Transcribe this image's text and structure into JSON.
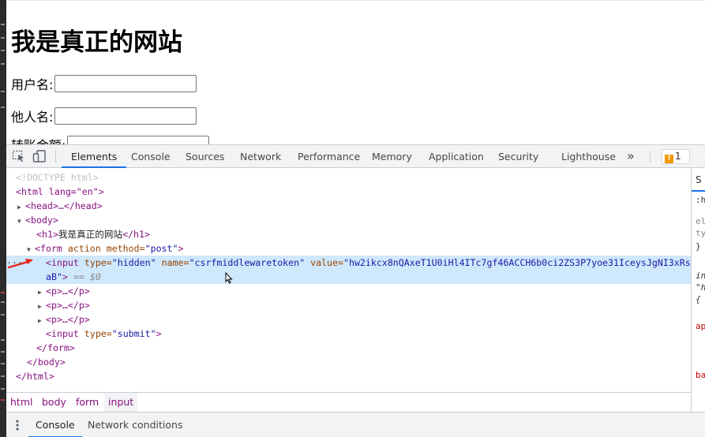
{
  "page": {
    "heading": "我是真正的网站",
    "fields": [
      {
        "label": "用户名:",
        "value": ""
      },
      {
        "label": "他人名:",
        "value": ""
      },
      {
        "label": "转账金额:",
        "value": ""
      }
    ]
  },
  "devtools": {
    "tabs": [
      "Elements",
      "Console",
      "Sources",
      "Network",
      "Performance",
      "Memory",
      "Application",
      "Security",
      "Lighthouse"
    ],
    "active_tab": "Elements",
    "more_tabs": "»",
    "issues_count": "1",
    "dom": {
      "doctype": "<!DOCTYPE html>",
      "html_open": "<html lang=\"en\">",
      "head": "<head>…</head>",
      "body_open": "<body>",
      "h1_open": "<h1>",
      "h1_text": "我是真正的网站",
      "h1_close": "</h1>",
      "form_open_tag": "<form",
      "form_attrs": " action method=",
      "form_method": "\"post\"",
      "form_open_end": ">",
      "input_tag": "<input",
      "input_type_attr": " type=",
      "input_type_val": "\"hidden\"",
      "input_name_attr": " name=",
      "input_name_val": "\"csrfmiddlewaretoken\"",
      "input_value_attr": " value=",
      "input_value_val": "\"hw2ikcx8nQAxeT1U0iHl4ITc7gf46ACCH6b0ci2ZS3P7yoe31IceysJgNI3xRs",
      "input_value_val2": "aB\"",
      "input_end": ">",
      "selected_marker": " == $0",
      "p_collapsed": "<p>…</p>",
      "submit_tag": "<input",
      "submit_type_attr": " type=",
      "submit_type_val": "\"submit\"",
      "submit_end": ">",
      "form_close": "</form>",
      "body_close": "</body>",
      "html_close": "</html>",
      "dots": "···"
    },
    "side_pane": {
      "tab": "S",
      "lines": [
        ":h",
        "el",
        "ty",
        "}",
        "in",
        "\"h",
        "{",
        "ap",
        "ba"
      ]
    },
    "breadcrumbs": [
      "html",
      "body",
      "form",
      "input"
    ],
    "active_breadcrumb": "input",
    "drawer_tabs": [
      "Console",
      "Network conditions"
    ],
    "active_drawer_tab": "Console"
  },
  "colors": {
    "accent": "#1a73e8",
    "selected_row": "#cfe8fc",
    "tag": "#881280",
    "attr": "#994500",
    "value": "#1a1aa6",
    "arrow": "#e8251c"
  },
  "icons": [
    "inspect-element-icon",
    "device-toolbar-icon",
    "warning-icon",
    "kebab-menu-icon",
    "red-arrow-icon",
    "mouse-cursor-icon"
  ]
}
